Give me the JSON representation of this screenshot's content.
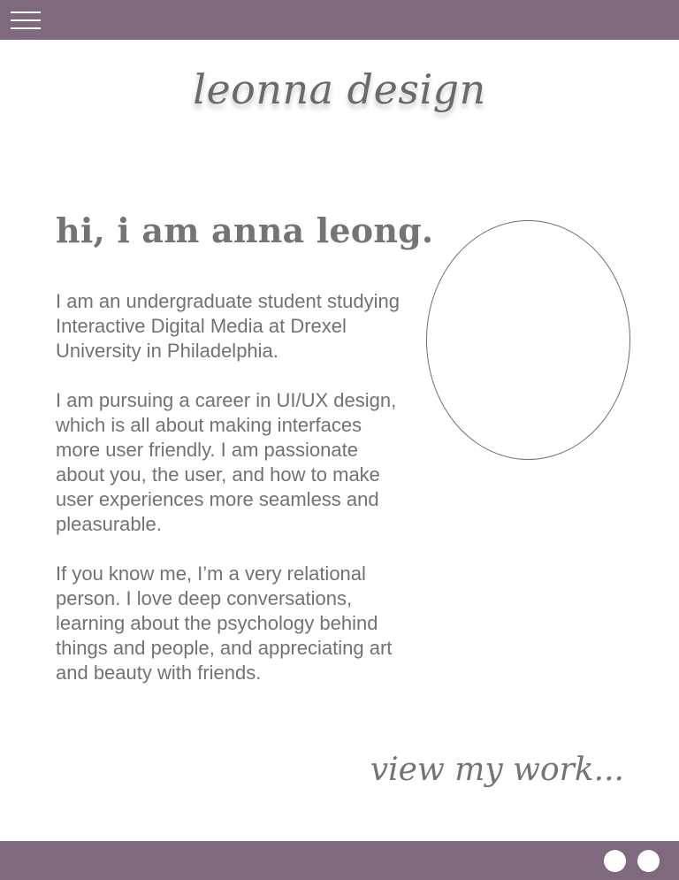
{
  "header": {
    "menu_icon": "hamburger-menu-icon"
  },
  "brand": {
    "logo_text": "leonna design"
  },
  "intro": {
    "heading": "hi, i am anna leong.",
    "paragraphs": [
      "I am an undergraduate student studying Interactive Digital Media at Drexel University in Philadelphia.",
      "I am pursuing a career in UI/UX design, which is all about making interfaces more user friendly. I am passionate about you, the user, and how to make user experiences more seamless and pleasurable.",
      "If you know me, I’m a very relational person. I love deep conversations, learning about the psychology behind things and people, and appreciating art and beauty with friends."
    ]
  },
  "cta": {
    "view_work_label": "view my work..."
  },
  "footer": {
    "social_icons": [
      "social-icon-1",
      "social-icon-2"
    ]
  },
  "colors": {
    "bar": "#7e697d",
    "text": "#747474",
    "background": "#ffffff"
  }
}
